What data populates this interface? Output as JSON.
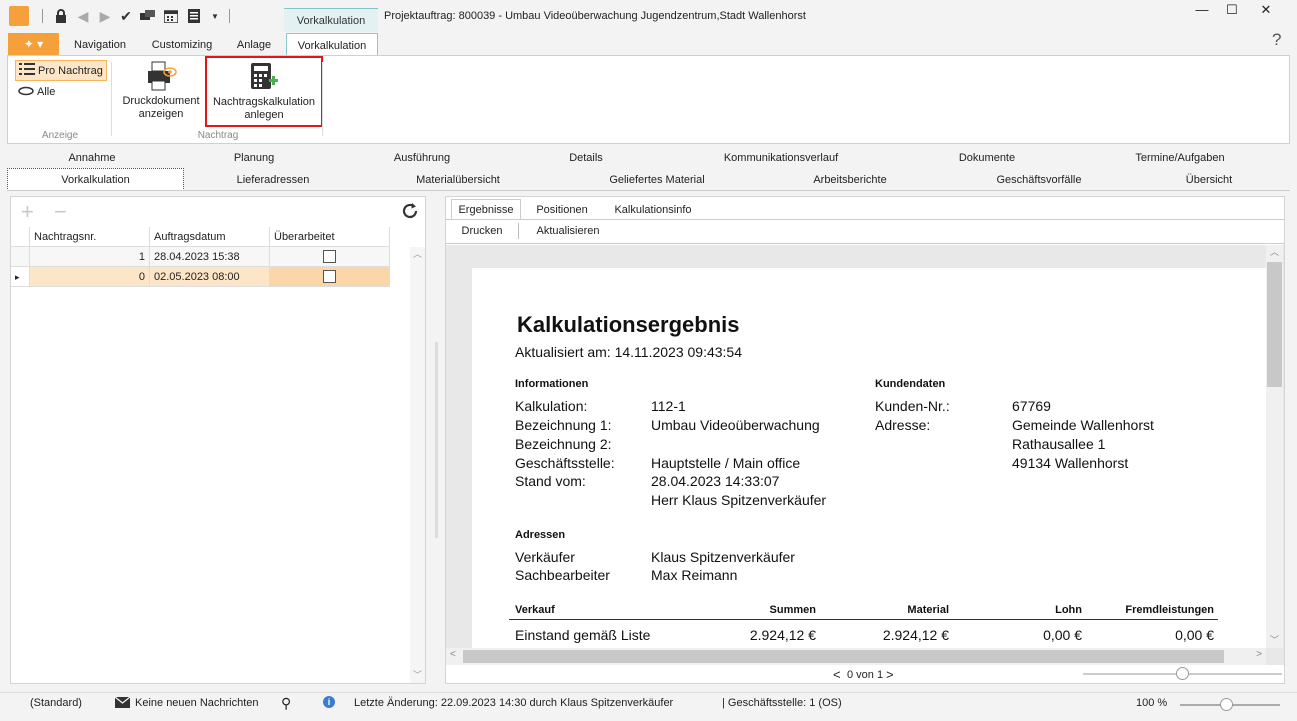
{
  "titlebar": {
    "context_tab": "Vorkalkulation",
    "window_title": "Projektauftrag: 800039 - Umbau Videoüberwachung Jugendzentrum,Stadt Wallenhorst",
    "minimize": "—",
    "maximize": "☐",
    "close": "✕"
  },
  "ribbon_tabs": [
    "Navigation",
    "Customizing",
    "Anlage",
    "Vorkalkulation"
  ],
  "help": "?",
  "ribbon": {
    "anzeige": {
      "pro_nachtrag": "Pro Nachtrag",
      "alle": "Alle",
      "label": "Anzeige"
    },
    "nachtrag": {
      "druckdokument_line1": "Druckdokument",
      "druckdokument_line2": "anzeigen",
      "kalkulation_line1": "Nachtragskalkulation",
      "kalkulation_line2": "anlegen",
      "label": "Nachtrag"
    },
    "highlight_color": "#e0161d"
  },
  "module_tabs_row1": [
    "Annahme",
    "Planung",
    "Ausführung",
    "Details",
    "Kommunikationsverlauf",
    "Dokumente",
    "Termine/Aufgaben"
  ],
  "module_tabs_row2": [
    "Vorkalkulation",
    "Lieferadressen",
    "Materialübersicht",
    "Geliefertes Material",
    "Arbeitsberichte",
    "Geschäftsvorfälle",
    "Übersicht"
  ],
  "grid": {
    "columns": [
      "Nachtragsnr.",
      "Auftragsdatum",
      "Überarbeitet"
    ],
    "rows": [
      {
        "nr": "1",
        "datum": "28.04.2023 15:38",
        "checked": false
      },
      {
        "nr": "0",
        "datum": "02.05.2023 08:00",
        "checked": false
      }
    ],
    "selected_color": "#fde6c8"
  },
  "panel_tabs": [
    "Ergebnisse",
    "Positionen",
    "Kalkulationsinfo"
  ],
  "panel_toolbar": {
    "drucken": "Drucken",
    "aktualisieren": "Aktualisieren"
  },
  "report": {
    "title": "Kalkulationsergebnis",
    "updated": "Aktualisiert am: 14.11.2023 09:43:54",
    "info_heading": "Informationen",
    "kunden_heading": "Kundendaten",
    "info": {
      "kalkulation_label": "Kalkulation:",
      "kalkulation": "112-1",
      "bez1_label": "Bezeichnung 1:",
      "bez1": "Umbau Videoüberwachung",
      "bez2_label": "Bezeichnung 2:",
      "gs_label": "Geschäftsstelle:",
      "gs": "Hauptstelle / Main office",
      "stand_label": "Stand vom:",
      "stand": "28.04.2023 14:33:07",
      "stand_by": "Herr Klaus Spitzenverkäufer"
    },
    "kunde": {
      "nr_label": "Kunden-Nr.:",
      "nr": "67769",
      "adr_label": "Adresse:",
      "adr1": "Gemeinde Wallenhorst",
      "adr2": "Rathausallee 1",
      "adr3": "49134 Wallenhorst"
    },
    "adressen_heading": "Adressen",
    "adressen": {
      "verk_label": "Verkäufer",
      "verk": "Klaus Spitzenverkäufer",
      "sb_label": "Sachbearbeiter",
      "sb": "Max Reimann"
    },
    "table": {
      "headers": [
        "Verkauf",
        "Summen",
        "Material",
        "Lohn",
        "Fremdleistungen"
      ],
      "row": [
        "Einstand gemäß Liste",
        "2.924,12 €",
        "2.924,12 €",
        "0,00 €",
        "0,00 €"
      ]
    }
  },
  "pager": "0 von 1",
  "status": {
    "standard": "(Standard)",
    "messages": "Keine neuen Nachrichten",
    "last_change": "Letzte Änderung: 22.09.2023 14:30 durch Klaus Spitzenverkäufer",
    "office": "| Geschäftsstelle:  1 (OS)",
    "zoom": "100 %"
  }
}
